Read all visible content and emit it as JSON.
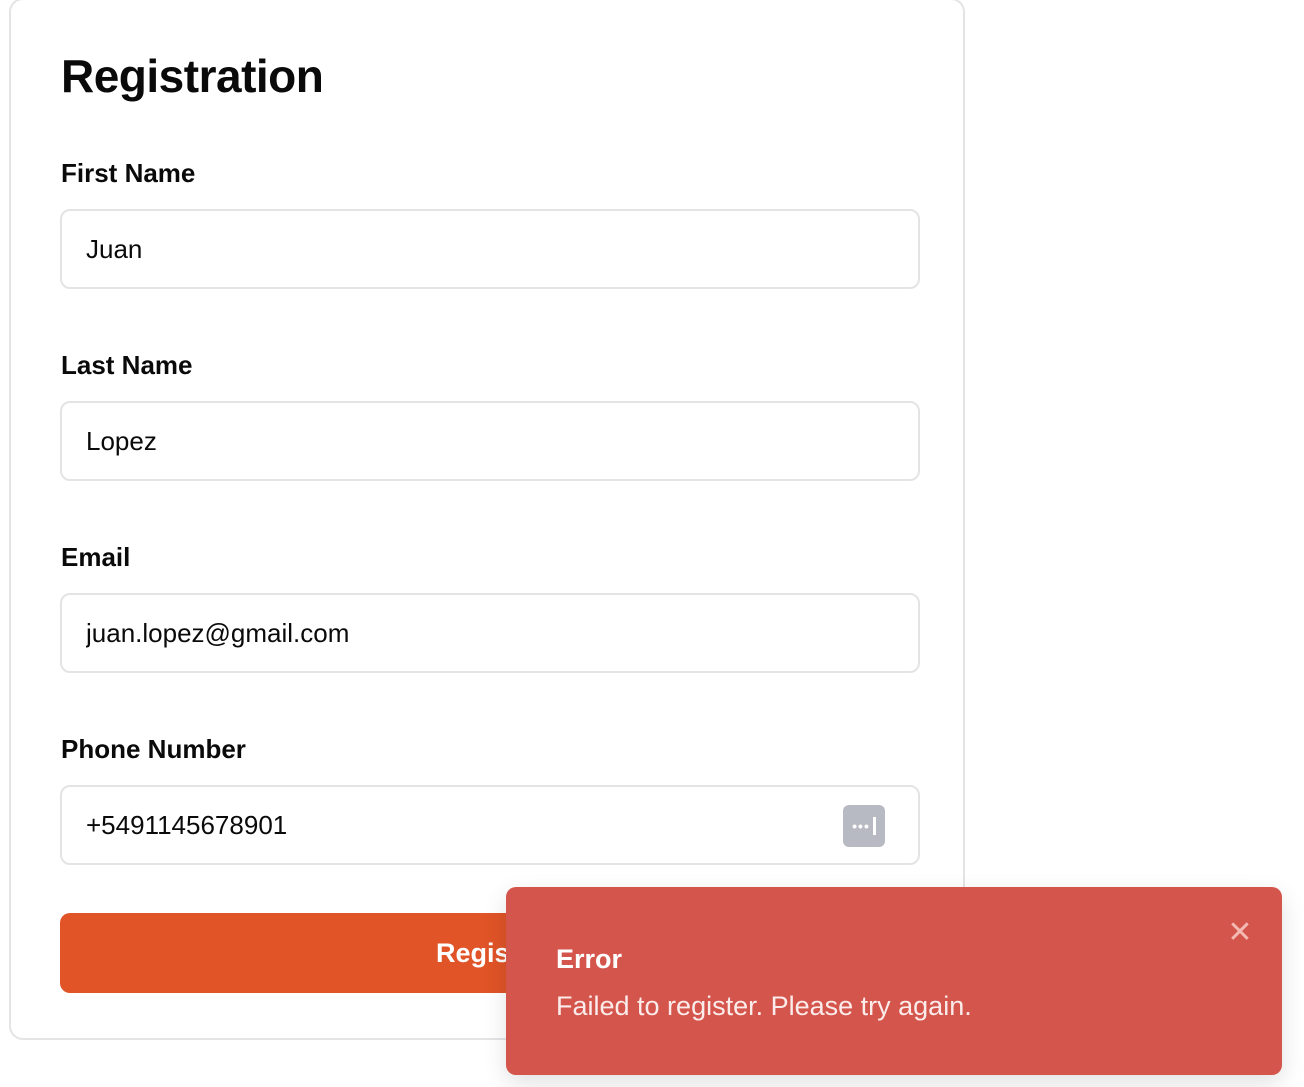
{
  "form": {
    "title": "Registration",
    "fields": [
      {
        "label": "First Name",
        "value": "Juan"
      },
      {
        "label": "Last Name",
        "value": "Lopez"
      },
      {
        "label": "Email",
        "value": "juan.lopez@gmail.com"
      },
      {
        "label": "Phone Number",
        "value": "+5491145678901"
      }
    ],
    "submit_label": "Register"
  },
  "toast": {
    "title": "Error",
    "message": "Failed to register. Please try again.",
    "close_icon": "close-icon"
  },
  "colors": {
    "primary_button": "#e05427",
    "toast_background": "#d4554b",
    "border": "#e4e4e7"
  }
}
